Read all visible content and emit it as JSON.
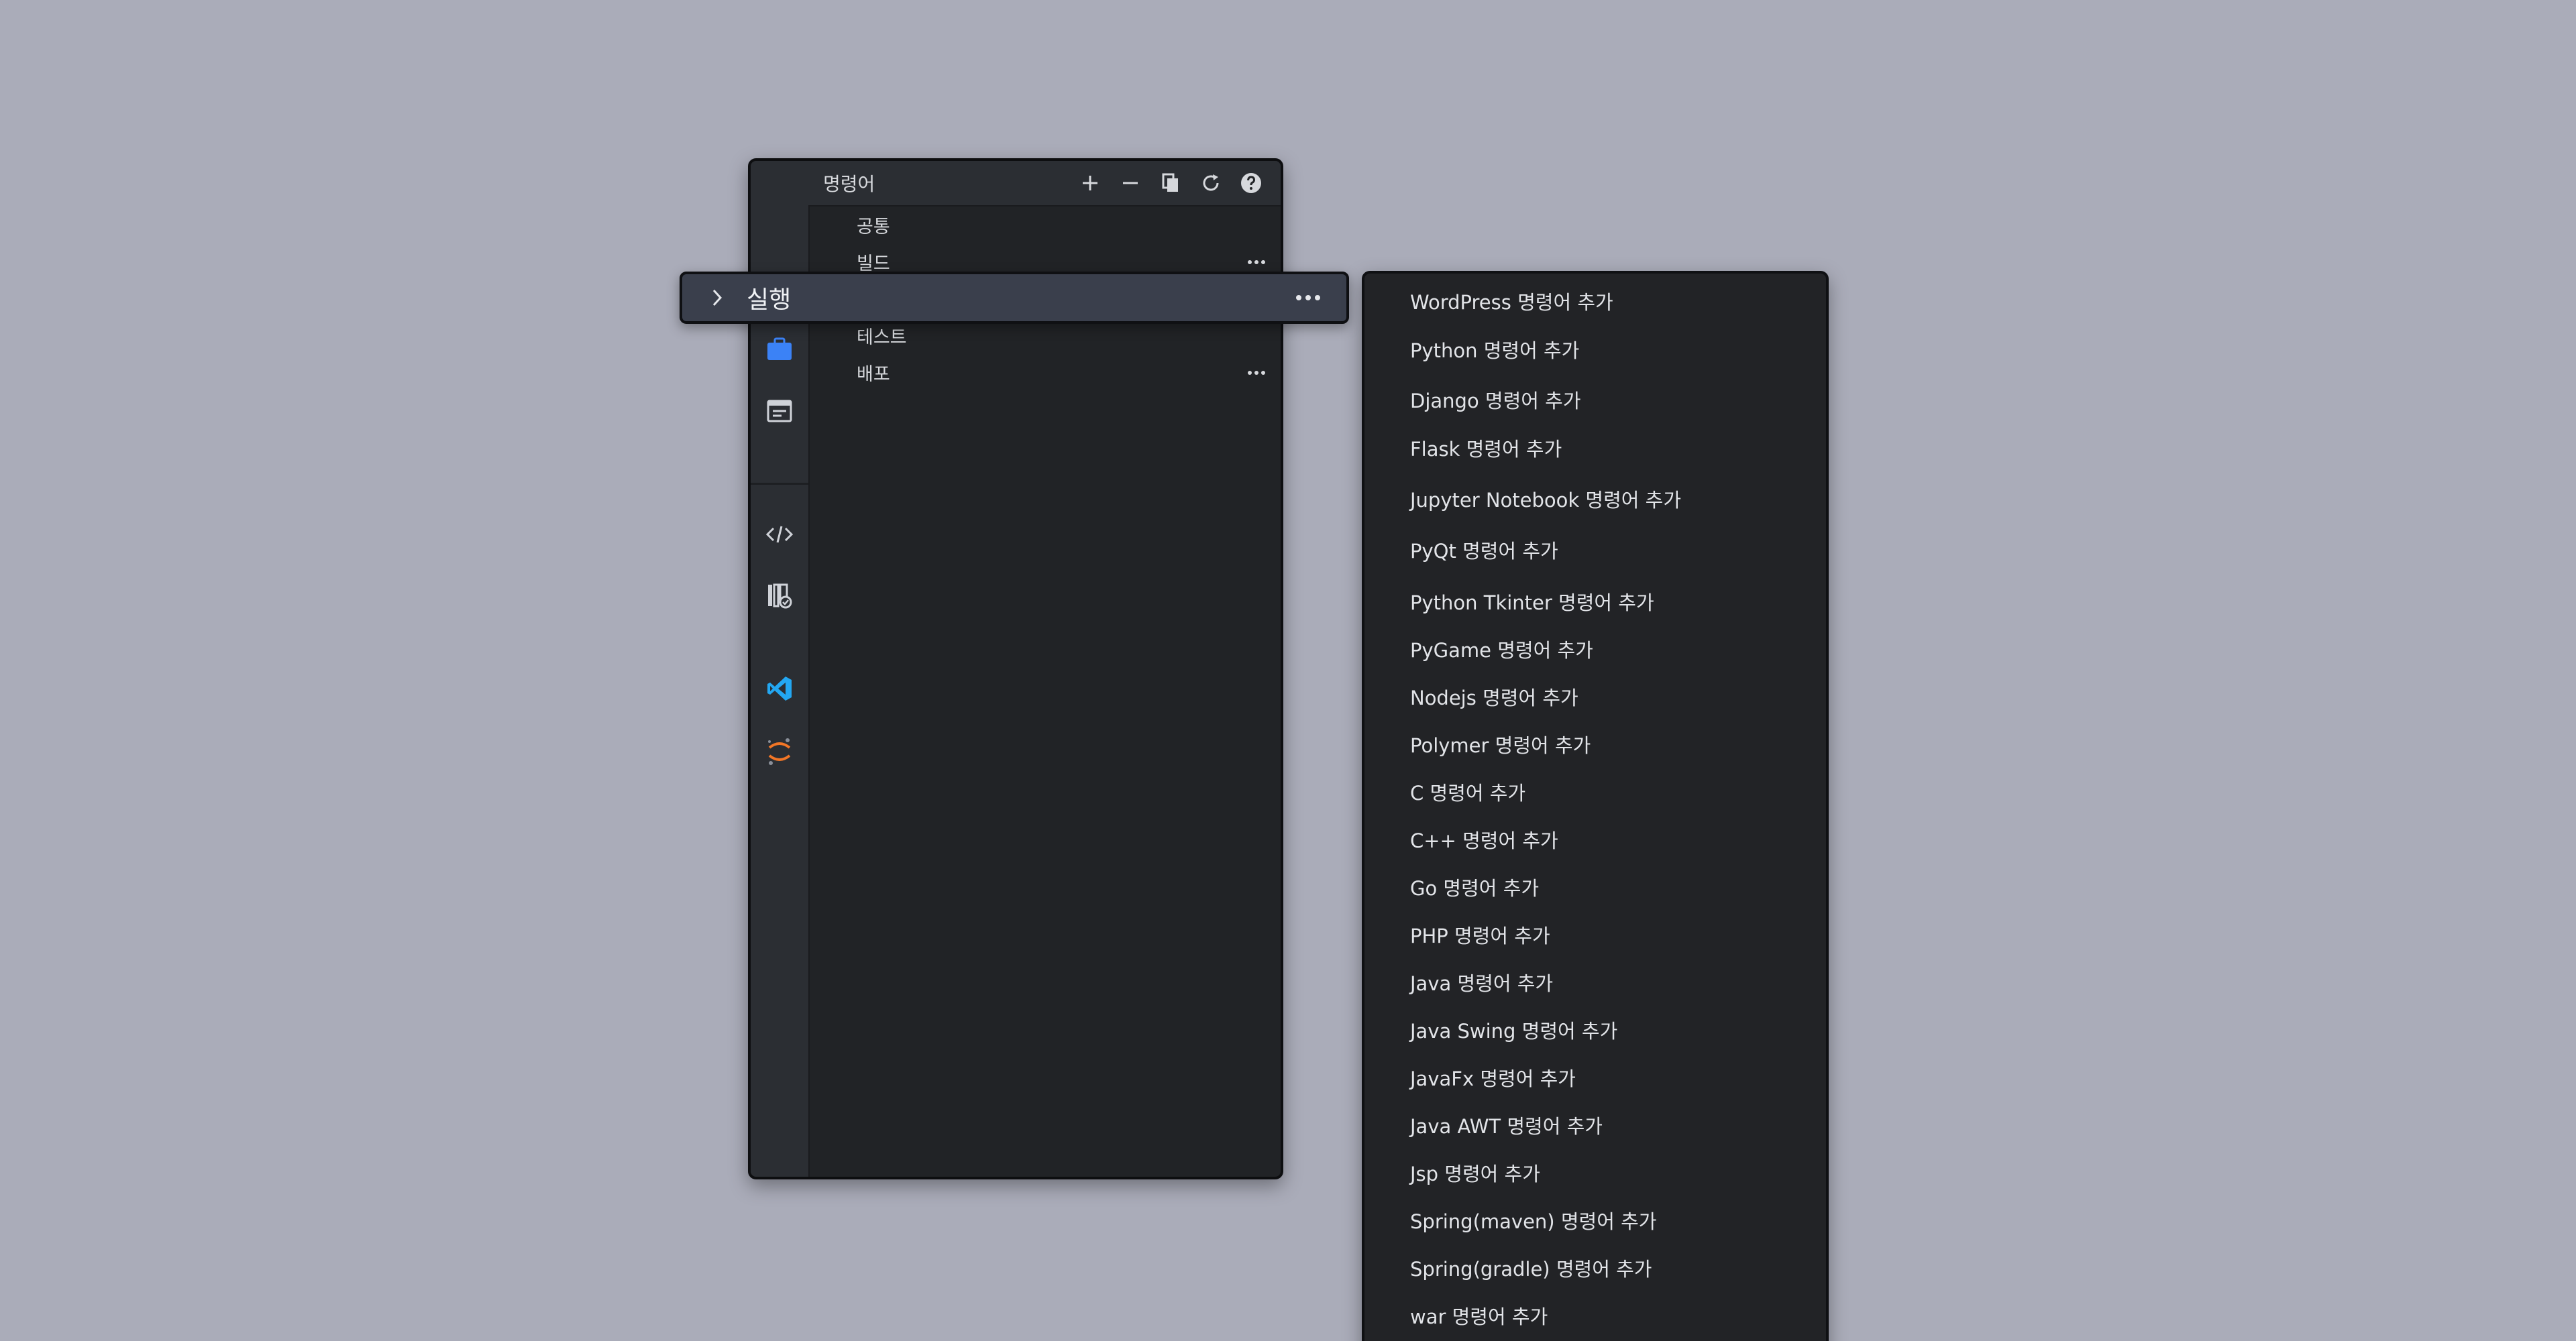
{
  "panel": {
    "title": "명령어",
    "toolbar": [
      {
        "name": "add-icon"
      },
      {
        "name": "remove-icon"
      },
      {
        "name": "copy-icon"
      },
      {
        "name": "refresh-icon"
      },
      {
        "name": "help-icon"
      }
    ],
    "activity_icons": [
      "briefcase-icon",
      "browser-window-icon",
      "code-icon",
      "library-icon",
      "vscode-icon",
      "jupyter-icon"
    ],
    "tree": [
      {
        "label": "공통",
        "has_more": false
      },
      {
        "label": "빌드",
        "has_more": true
      },
      {
        "label": "테스트",
        "has_more": false
      },
      {
        "label": "배포",
        "has_more": true
      }
    ]
  },
  "drag_row": {
    "label": "실행"
  },
  "menu": {
    "items": [
      "WordPress 명령어 추가",
      "Python 명령어 추가",
      "Django 명령어 추가",
      "Flask 명령어 추가",
      "Jupyter Notebook 명령어 추가",
      "PyQt 명령어 추가",
      "Python Tkinter 명령어 추가",
      "PyGame 명령어 추가",
      "Nodejs 명령어 추가",
      "Polymer 명령어 추가",
      "C 명령어 추가",
      "C++ 명령어 추가",
      "Go 명령어 추가",
      "PHP 명령어 추가",
      "Java 명령어 추가",
      "Java Swing 명령어 추가",
      "JavaFx 명령어 추가",
      "Java AWT 명령어 추가",
      "Jsp 명령어 추가",
      "Spring(maven) 명령어 추가",
      "Spring(gradle) 명령어 추가",
      "war 명령어 추가"
    ]
  },
  "colors": {
    "background": "#aaacb9",
    "panel": "#212326",
    "accent_blue": "#3b82f6",
    "vscode_blue": "#23a7f2",
    "jupyter_orange": "#f37626",
    "drag_highlight": "#3a3f4c"
  }
}
